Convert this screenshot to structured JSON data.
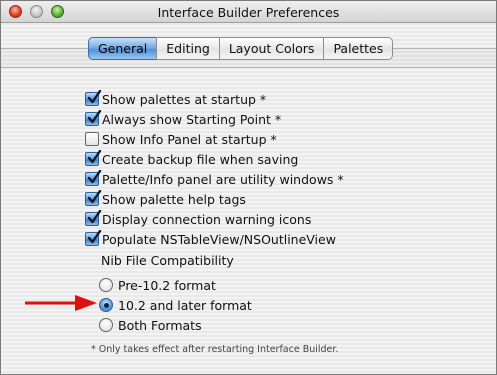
{
  "window": {
    "title": "Interface Builder Preferences"
  },
  "tabs": [
    {
      "label": "General",
      "active": true
    },
    {
      "label": "Editing",
      "active": false
    },
    {
      "label": "Layout Colors",
      "active": false
    },
    {
      "label": "Palettes",
      "active": false
    }
  ],
  "options": [
    {
      "label": "Show palettes at startup *",
      "checked": true
    },
    {
      "label": "Always show Starting Point *",
      "checked": true
    },
    {
      "label": "Show Info Panel at startup *",
      "checked": false
    },
    {
      "label": "Create backup file when saving",
      "checked": true
    },
    {
      "label": "Palette/Info panel are utility windows *",
      "checked": true
    },
    {
      "label": "Show palette help tags",
      "checked": true
    },
    {
      "label": "Display connection warning icons",
      "checked": true
    },
    {
      "label": "Populate NSTableView/NSOutlineView",
      "checked": true
    }
  ],
  "nib": {
    "label": "Nib File Compatibility",
    "options": [
      {
        "label": "Pre-10.2 format",
        "selected": false
      },
      {
        "label": "10.2 and later format",
        "selected": true
      },
      {
        "label": "Both Formats",
        "selected": false
      }
    ]
  },
  "footnote": "* Only takes effect after restarting Interface Builder.",
  "colors": {
    "accent": "#4f8fd6",
    "annotation_arrow": "#e01010"
  },
  "icons": {
    "annotation": "red-arrow-icon"
  }
}
